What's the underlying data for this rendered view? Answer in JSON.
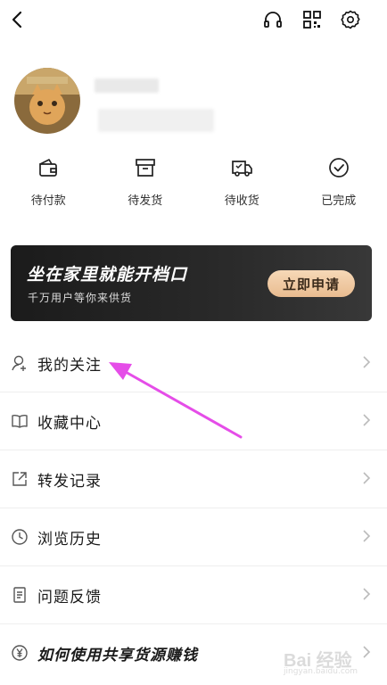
{
  "header": {
    "back_icon": "back-arrow-icon",
    "actions": [
      "headset-icon",
      "qr-code-icon",
      "gear-icon"
    ]
  },
  "profile": {
    "avatar": "avatar-image"
  },
  "orders": [
    {
      "label": "待付款",
      "icon": "wallet-icon"
    },
    {
      "label": "待发货",
      "icon": "box-icon"
    },
    {
      "label": "待收货",
      "icon": "truck-icon"
    },
    {
      "label": "已完成",
      "icon": "check-circle-icon"
    }
  ],
  "banner": {
    "title": "坐在家里就能开档口",
    "subtitle": "千万用户等你来供货",
    "apply_label": "立即申请"
  },
  "menu": [
    {
      "label": "我的关注",
      "icon": "user-follow-icon"
    },
    {
      "label": "收藏中心",
      "icon": "book-icon"
    },
    {
      "label": "转发记录",
      "icon": "share-icon"
    },
    {
      "label": "浏览历史",
      "icon": "clock-icon"
    },
    {
      "label": "问题反馈",
      "icon": "feedback-icon"
    },
    {
      "label": "如何使用共享货源赚钱",
      "icon": "yuan-icon"
    }
  ],
  "watermark": {
    "text": "Bai 经验",
    "url": "jingyan.baidu.com"
  },
  "colors": {
    "banner_bg": "#1b1b1b",
    "apply_button": "#efc8a0",
    "annotation_arrow": "#e54de8"
  }
}
